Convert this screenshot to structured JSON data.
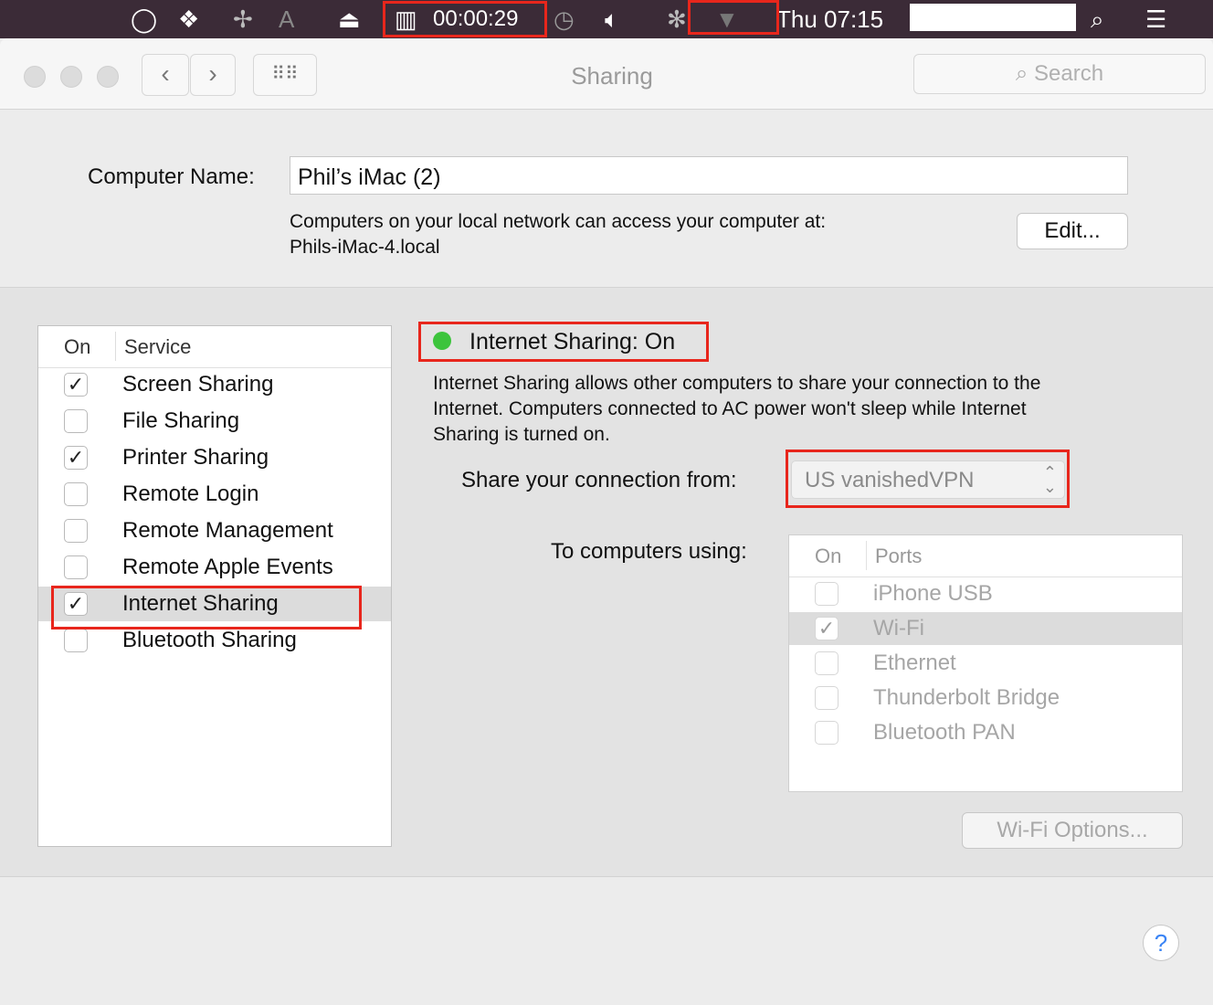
{
  "menubar": {
    "timer": "00:00:29",
    "clock": "Thu 07:15",
    "icons": [
      "opera-icon",
      "dropbox-icon",
      "pinwheel-icon",
      "adobe-icon",
      "airplay-icon",
      "timer-icon",
      "time-machine-icon",
      "volume-icon",
      "bluetooth-icon",
      "wifi-icon",
      "spotlight-icon",
      "notification-center-icon"
    ]
  },
  "window": {
    "title": "Sharing",
    "search_placeholder": "Search"
  },
  "computer": {
    "label": "Computer Name:",
    "value": "Phil’s iMac (2)",
    "info_line1": "Computers on your local network can access your computer at:",
    "info_line2": "Phils-iMac-4.local",
    "edit_label": "Edit..."
  },
  "services": {
    "col_on": "On",
    "col_service": "Service",
    "items": [
      {
        "label": "Screen Sharing",
        "checked": true
      },
      {
        "label": "File Sharing",
        "checked": false
      },
      {
        "label": "Printer Sharing",
        "checked": true
      },
      {
        "label": "Remote Login",
        "checked": false
      },
      {
        "label": "Remote Management",
        "checked": false
      },
      {
        "label": "Remote Apple Events",
        "checked": false
      },
      {
        "label": "Internet Sharing",
        "checked": true,
        "selected": true
      },
      {
        "label": "Bluetooth Sharing",
        "checked": false
      }
    ]
  },
  "detail": {
    "status": "Internet Sharing: On",
    "status_color": "#3cc43c",
    "desc1": "Internet Sharing allows other computers to share your connection to the",
    "desc2": "Internet. Computers connected to AC power won't sleep while Internet",
    "desc3": "Sharing is turned on.",
    "share_from_label": "Share your connection from:",
    "share_from_value": "US vanishedVPN",
    "to_label": "To computers using:",
    "col_on": "On",
    "col_ports": "Ports",
    "ports": [
      {
        "label": "iPhone USB",
        "checked": false
      },
      {
        "label": "Wi-Fi",
        "checked": true,
        "selected": true
      },
      {
        "label": "Ethernet",
        "checked": false
      },
      {
        "label": "Thunderbolt Bridge",
        "checked": false
      },
      {
        "label": "Bluetooth PAN",
        "checked": false
      }
    ],
    "wifi_options": "Wi-Fi Options..."
  },
  "help": "?",
  "highlight_color": "#e8261c"
}
